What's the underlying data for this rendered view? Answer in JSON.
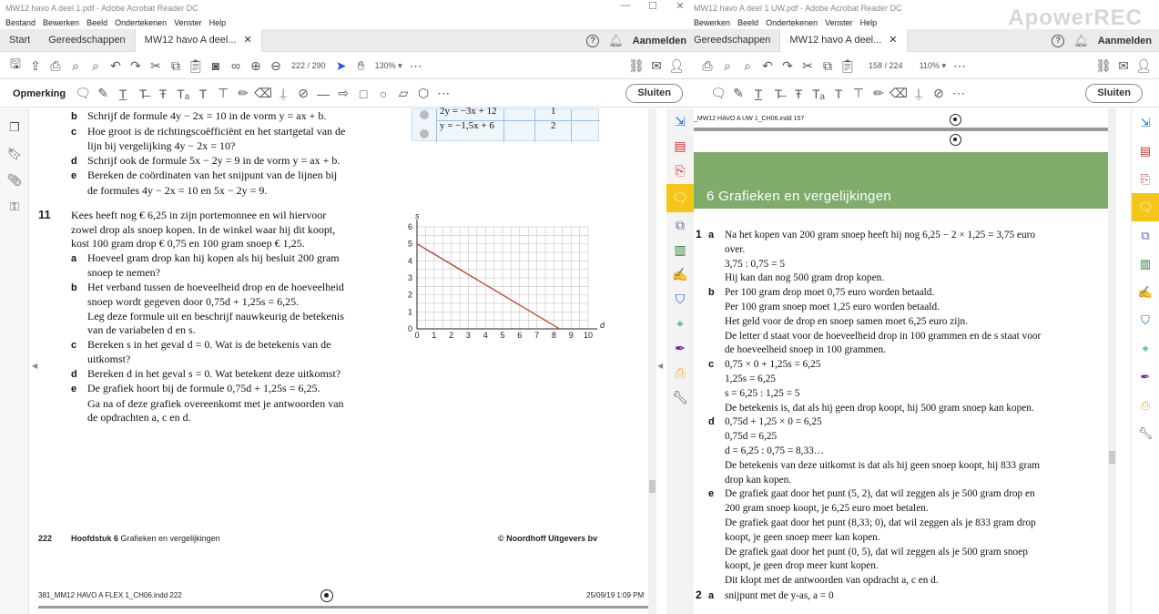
{
  "left": {
    "title": "MW12 havo A deel 1.pdf - Adobe Acrobat Reader DC",
    "menu": [
      "Bestand",
      "Bewerken",
      "Beeld",
      "Ondertekenen",
      "Venster",
      "Help"
    ],
    "tabs": {
      "start": "Start",
      "tools": "Gereedschappen",
      "doc": "MW12 havo A deel...",
      "signin": "Aanmelden"
    },
    "page_current": "222",
    "page_total": "/ 290",
    "zoom": "130%",
    "comment_label": "Opmerking",
    "close_label": "Sluiten",
    "table_rows": [
      "2y = −3x + 12",
      "1",
      "y = −1,5x + 6",
      "2"
    ],
    "q10": [
      {
        "l": "b",
        "t": "Schrijf de formule 4y − 2x = 10 in de vorm y = ax + b."
      },
      {
        "l": "c",
        "t": "Hoe groot is de richtingscoëfficiënt en het startgetal van de"
      },
      {
        "l": "",
        "t": "lijn bij vergelijking 4y − 2x = 10?"
      },
      {
        "l": "d",
        "t": "Schrijf ook de formule 5x − 2y = 9 in de vorm y = ax + b."
      },
      {
        "l": "e",
        "t": "Bereken de coördinaten van het snijpunt van de lijnen bij"
      },
      {
        "l": "",
        "t": "de formules 4y − 2x = 10 en 5x − 2y = 9."
      }
    ],
    "q11_number": "11",
    "q11": [
      {
        "l": "",
        "t": "Kees heeft nog € 6,25 in zijn portemonnee en wil hiervoor"
      },
      {
        "l": "",
        "t": "zowel drop als snoep kopen. In de winkel waar hij dit koopt,"
      },
      {
        "l": "",
        "t": "kost 100 gram drop € 0,75 en 100 gram snoep € 1,25."
      },
      {
        "l": "a",
        "t": "Hoeveel gram drop kan hij kopen als hij besluit 200 gram"
      },
      {
        "l": "",
        "t": "snoep te nemen?"
      },
      {
        "l": "b",
        "t": "Het verband tussen de hoeveelheid drop en de hoeveelheid"
      },
      {
        "l": "",
        "t": "snoep wordt gegeven door 0,75d + 1,25s = 6,25."
      },
      {
        "l": "",
        "t": "Leg deze formule uit en beschrijf nauwkeurig de betekenis"
      },
      {
        "l": "",
        "t": "van de variabelen d en s."
      },
      {
        "l": "c",
        "t": "Bereken s in het geval d = 0. Wat is de betekenis van de"
      },
      {
        "l": "",
        "t": "uitkomst?"
      },
      {
        "l": "d",
        "t": "Bereken d in het geval s = 0. Wat betekent deze uitkomst?"
      },
      {
        "l": "e",
        "t": "De grafiek hoort bij de formule 0,75d + 1,25s = 6,25."
      },
      {
        "l": "",
        "t": "Ga na of deze grafiek overeenkomt met je antwoorden van"
      },
      {
        "l": "",
        "t": "de opdrachten a, c en d."
      }
    ],
    "footer_page": "222",
    "footer_chapter_bold": "Hoofdstuk 6",
    "footer_chapter": "Grafieken en vergelijkingen",
    "footer_publisher": "© Noordhoff Uitgevers bv",
    "footer_file": "381_MM12 HAVO A FLEX 1_CH06.indd   222",
    "footer_date": "25/09/19   1:09 PM"
  },
  "chart_data": {
    "type": "line",
    "xlabel": "d",
    "ylabel": "s",
    "xlim": [
      0,
      10
    ],
    "ylim": [
      0,
      6
    ],
    "xticks": [
      "0",
      "1",
      "2",
      "3",
      "4",
      "5",
      "6",
      "7",
      "8",
      "9",
      "10"
    ],
    "yticks": [
      "0",
      "1",
      "2",
      "3",
      "4",
      "5",
      "6"
    ],
    "grid": true,
    "series": [
      {
        "x": [
          0,
          8.33
        ],
        "y": [
          5,
          0
        ],
        "color": "#c0392b"
      }
    ]
  },
  "right": {
    "title": "MW12 havo A deel 1 UW.pdf - Adobe Acrobat Reader DC",
    "menu": [
      "Bewerken",
      "Beeld",
      "Ondertekenen",
      "Venster",
      "Help"
    ],
    "tabs": {
      "tools": "Gereedschappen",
      "doc": "MW12 havo A deel...",
      "signin": "Aanmelden"
    },
    "page_current": "158",
    "page_total": "/ 224",
    "zoom": "110%",
    "close_label": "Sluiten",
    "indd": "_MW12 HAVO A UW 1_CH06.indd   157",
    "chapter": "6  Grafieken en vergelijkingen",
    "lines": [
      {
        "n": "1",
        "l": "a",
        "t": "Na het kopen van 200 gram snoep heeft hij nog 6,25 − 2 × 1,25 = 3,75 euro"
      },
      {
        "n": "",
        "l": "",
        "t": "over."
      },
      {
        "n": "",
        "l": "",
        "t": "3,75 : 0,75 = 5"
      },
      {
        "n": "",
        "l": "",
        "t": "Hij kan dan nog 500 gram drop kopen."
      },
      {
        "n": "",
        "l": "b",
        "t": "Per 100 gram drop moet 0,75 euro worden betaald."
      },
      {
        "n": "",
        "l": "",
        "t": "Per 100 gram snoep moet 1,25 euro worden betaald."
      },
      {
        "n": "",
        "l": "",
        "t": "Het geld voor de drop en snoep samen moet 6,25 euro zijn."
      },
      {
        "n": "",
        "l": "",
        "t": "De letter d staat voor de hoeveelheid drop in 100 grammen en de s staat voor"
      },
      {
        "n": "",
        "l": "",
        "t": "de hoeveelheid snoep in 100 grammen."
      },
      {
        "n": "",
        "l": "c",
        "t": "0,75 × 0 + 1,25s = 6,25"
      },
      {
        "n": "",
        "l": "",
        "t": "1,25s = 6,25"
      },
      {
        "n": "",
        "l": "",
        "t": "s = 6,25 : 1,25 = 5"
      },
      {
        "n": "",
        "l": "",
        "t": "De betekenis is, dat als hij geen drop koopt, hij 500 gram snoep kan kopen."
      },
      {
        "n": "",
        "l": "d",
        "t": "0,75d + 1,25 × 0 = 6,25"
      },
      {
        "n": "",
        "l": "",
        "t": "0,75d = 6,25"
      },
      {
        "n": "",
        "l": "",
        "t": "d = 6,25 : 0,75 = 8,33…"
      },
      {
        "n": "",
        "l": "",
        "t": "De betekenis van deze uitkomst is dat als hij geen snoep koopt, hij 833 gram"
      },
      {
        "n": "",
        "l": "",
        "t": "drop kan kopen."
      },
      {
        "n": "",
        "l": "e",
        "t": "De grafiek gaat door het punt (5, 2), dat wil zeggen als je 500 gram drop en"
      },
      {
        "n": "",
        "l": "",
        "t": "200 gram snoep koopt, je 6,25 euro moet betalen."
      },
      {
        "n": "",
        "l": "",
        "t": "De grafiek gaat door het punt (8,33; 0), dat wil zeggen als je 833 gram drop"
      },
      {
        "n": "",
        "l": "",
        "t": "koopt, je geen snoep meer kan kopen."
      },
      {
        "n": "",
        "l": "",
        "t": "De grafiek gaat door het punt (0, 5), dat wil zeggen als je 500 gram snoep"
      },
      {
        "n": "",
        "l": "",
        "t": "koopt, je geen drop meer kunt kopen."
      },
      {
        "n": "",
        "l": "",
        "t": "Dit klopt met de antwoorden van opdracht a, c en d."
      },
      {
        "n": "2",
        "l": "a",
        "t": "snijpunt met de y-as, a = 0"
      }
    ],
    "watermark": "ApowerREC"
  },
  "colors": {
    "accent": "#f5c518",
    "band": "#7fab6b",
    "line": "#c0392b"
  }
}
